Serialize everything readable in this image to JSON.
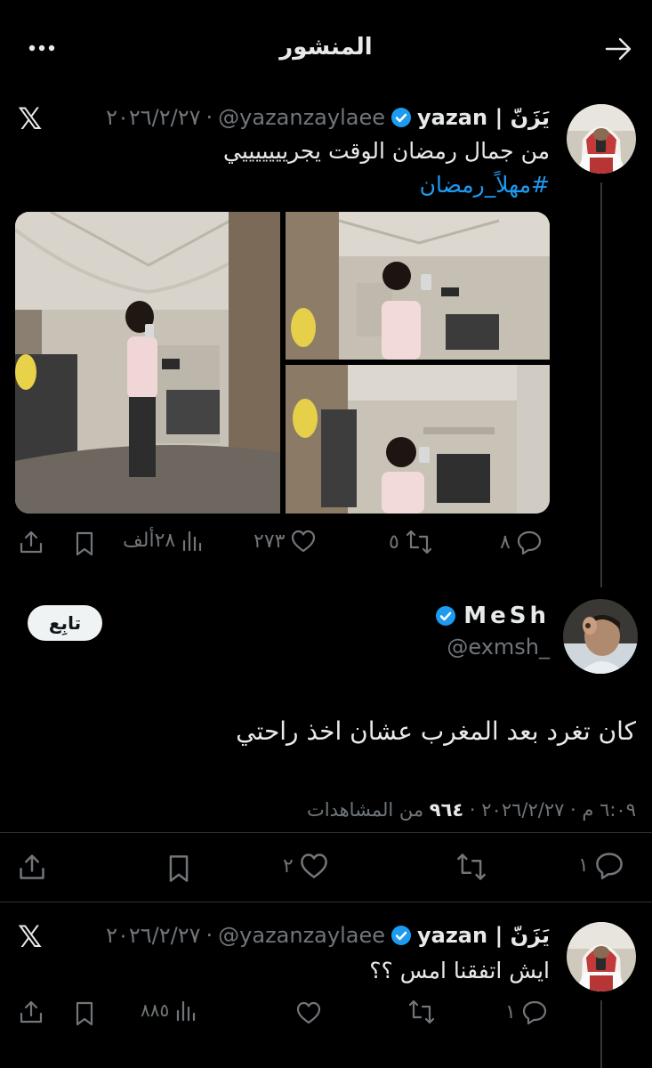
{
  "header": {
    "title": "المنشور",
    "back_icon": "arrow-right-icon",
    "more_icon": "more-icon"
  },
  "tweet1": {
    "display_name": "يَزَنّ | yazan",
    "handle": "@yazanzaylaee",
    "date": "٢٠٢٦/٢/٢٧",
    "text": "من جمال رمضان الوقت يجريييييييي",
    "hashtag": "#مهلاً_رمضان",
    "replies": "٨",
    "retweets": "٥",
    "likes": "٢٧٣",
    "views": "٢٨ألف"
  },
  "main": {
    "display_name": "MeSh",
    "handle": "@exmsh_",
    "follow_label": "تابِع",
    "text": "كان تغرد بعد المغرب عشان اخذ راحتي",
    "meta": "٦:٠٩ م · ٢٠٢٦/٢/٢٧ · ",
    "views_count": "٩٦٤",
    "views_label": " من المشاهدات",
    "replies": "١",
    "likes": "٢"
  },
  "tweet2": {
    "display_name": "يَزَنّ | yazan",
    "handle": "@yazanzaylaee",
    "date": "٢٠٢٦/٢/٢٧",
    "text": "ايش اتفقنا امس ؟؟",
    "replies": "١",
    "views": "٨٨٥"
  },
  "colors": {
    "background": "#000000",
    "text": "#e7e9ea",
    "muted": "#71767b",
    "link": "#1d9bf0",
    "verified": "#1d9bf0"
  }
}
